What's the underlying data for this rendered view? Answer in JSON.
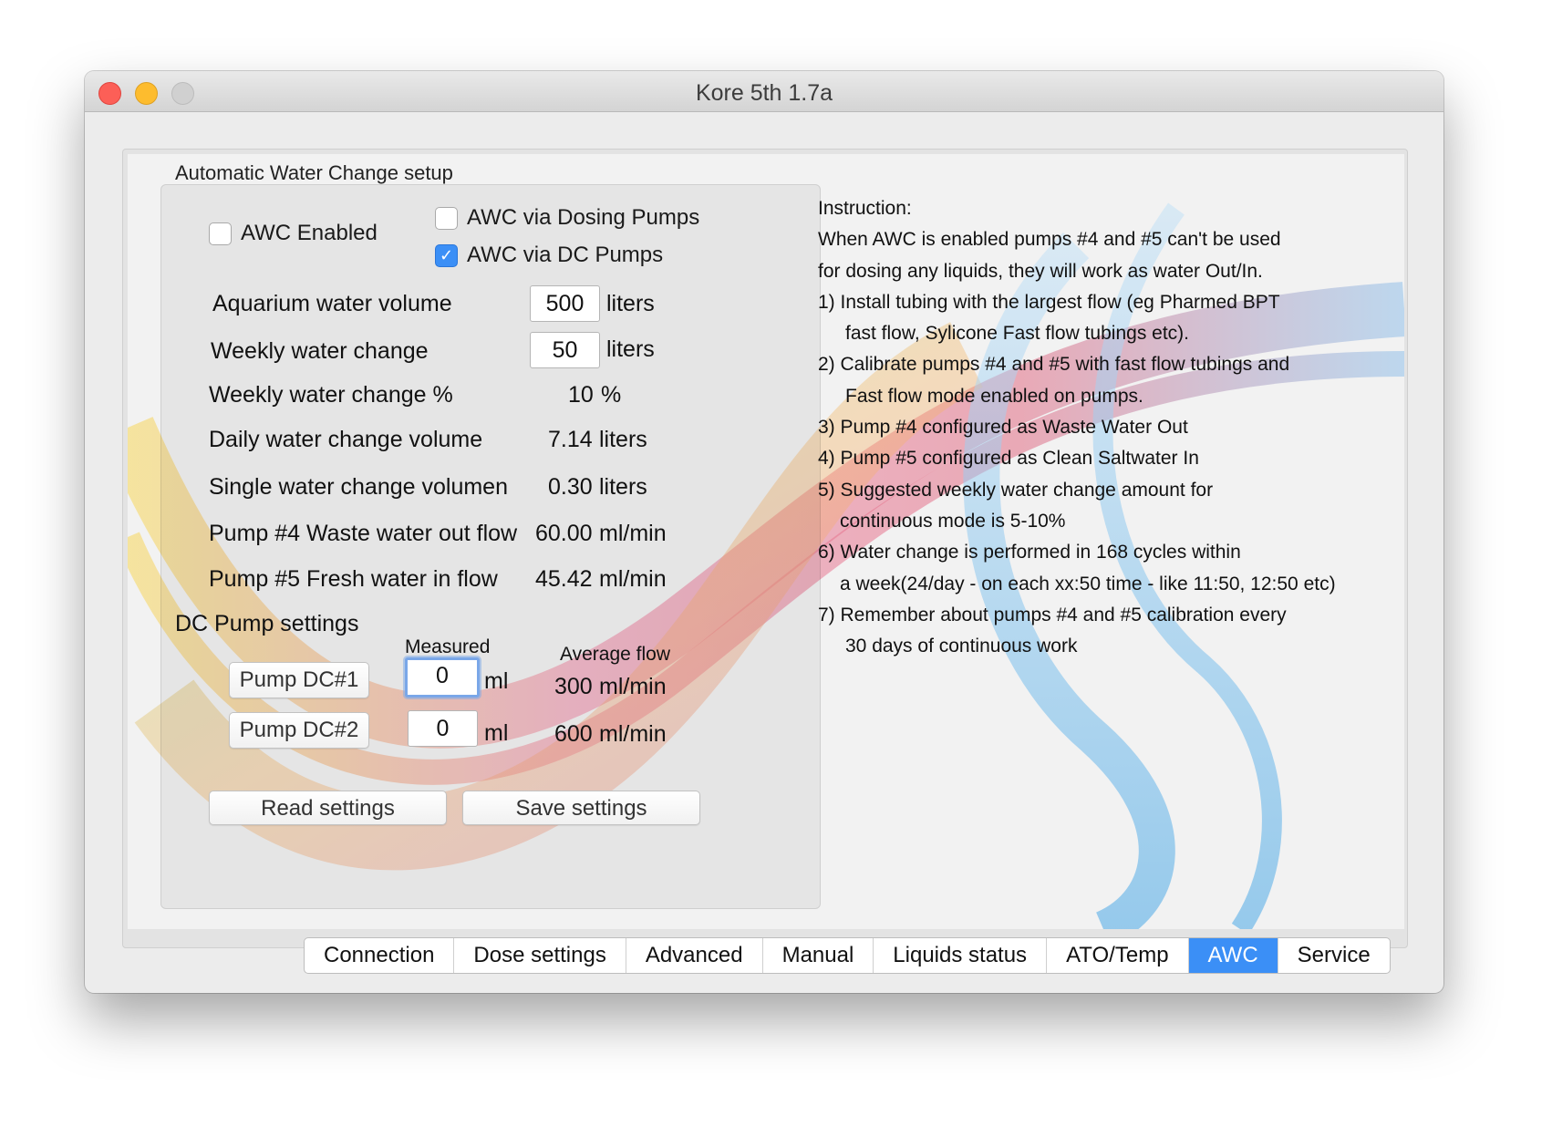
{
  "window": {
    "title": "Kore 5th 1.7a"
  },
  "awc": {
    "group_title": "Automatic Water Change setup",
    "awc_enabled": {
      "label": "AWC Enabled",
      "checked": false
    },
    "via_dosing": {
      "label": "AWC via Dosing Pumps",
      "checked": false
    },
    "via_dc": {
      "label": "AWC via DC Pumps",
      "checked": true
    },
    "rows": [
      {
        "label": "Aquarium water volume",
        "value": "500",
        "unit": "liters"
      },
      {
        "label": "Weekly water change",
        "value": "50",
        "unit": "liters"
      },
      {
        "label": "Weekly water change %",
        "value": "10",
        "unit": "%"
      },
      {
        "label": "Daily water change volume",
        "value": "7.14",
        "unit": "liters"
      },
      {
        "label": "Single water change volumen",
        "value": "0.30",
        "unit": "liters"
      },
      {
        "label": "Pump #4 Waste water out flow",
        "value": "60.00",
        "unit": "ml/min"
      },
      {
        "label": "Pump #5 Fresh water in flow",
        "value": "45.42",
        "unit": "ml/min"
      }
    ]
  },
  "dc": {
    "title": "DC Pump settings",
    "measured_header": "Measured",
    "avg_header": "Average flow",
    "pumps": [
      {
        "button": "Pump DC#1",
        "measured": "0",
        "unit": "ml",
        "avg": "300",
        "avg_unit": "ml/min"
      },
      {
        "button": "Pump DC#2",
        "measured": "0",
        "unit": "ml",
        "avg": "600",
        "avg_unit": "ml/min"
      }
    ]
  },
  "buttons": {
    "read": "Read settings",
    "save": "Save settings"
  },
  "instructions": [
    "Instruction:",
    "When AWC is enabled pumps #4 and #5 can't be used",
    "for dosing any liquids, they will work as water Out/In.",
    "1) Install tubing with the largest flow (eg Pharmed BPT",
    "fast flow, Sylicone Fast flow tubings etc).",
    "2) Calibrate pumps #4 and #5 with fast flow tubings and",
    "Fast flow mode enabled on pumps.",
    "3) Pump #4 configured as Waste Water Out",
    "4) Pump #5 configured as Clean Saltwater In",
    "5) Suggested weekly water change amount for",
    "continuous mode is 5-10%",
    "6) Water change is performed in 168 cycles within",
    "a week(24/day - on each xx:50 time - like 11:50, 12:50 etc)",
    "7) Remember about pumps #4 and #5 calibration every",
    "30 days of continuous work"
  ],
  "tabs": [
    "Connection",
    "Dose settings",
    "Advanced",
    "Manual",
    "Liquids status",
    "ATO/Temp",
    "AWC",
    "Service"
  ],
  "active_tab": "AWC",
  "colors": {
    "accent": "#3b8ff6",
    "close": "#fc5f57",
    "minimize": "#fdbc2e"
  }
}
